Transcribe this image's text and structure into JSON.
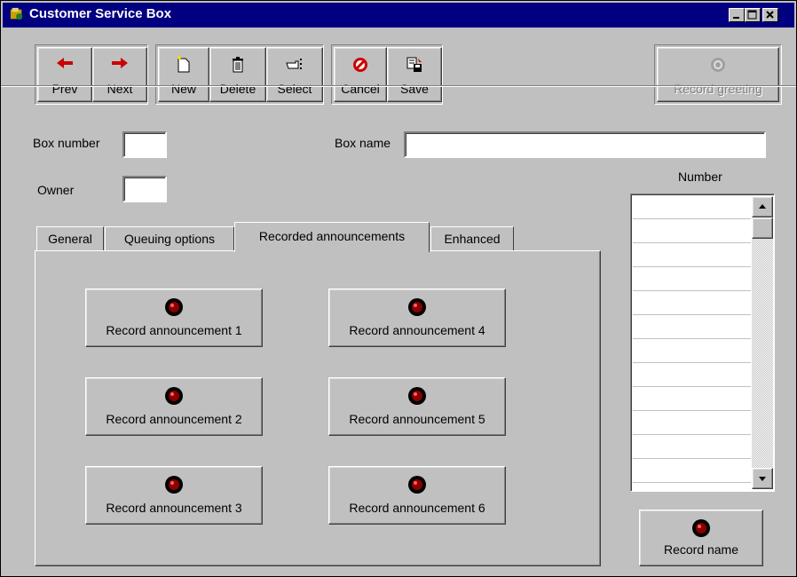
{
  "window": {
    "title": "Customer Service Box"
  },
  "titlebar_buttons": [
    "minimize-icon",
    "maximize-icon",
    "close-icon"
  ],
  "toolbar": {
    "prev_label": "Prev",
    "next_label": "Next",
    "new_label": "New",
    "delete_label": "Delete",
    "select_label": "Select",
    "cancel_label": "Cancel",
    "save_label": "Save",
    "record_greeting_label": "Record greeting"
  },
  "form": {
    "box_number_label": "Box number",
    "box_number_value": "",
    "box_name_label": "Box name",
    "box_name_value": "",
    "owner_label": "Owner",
    "owner_value": "",
    "number_label": "Number"
  },
  "tabs": [
    {
      "label": "General",
      "active": false
    },
    {
      "label": "Queuing options",
      "active": false
    },
    {
      "label": "Recorded announcements",
      "active": true
    },
    {
      "label": "Enhanced",
      "active": false
    }
  ],
  "announcements": {
    "a1": "Record announcement 1",
    "a2": "Record announcement 2",
    "a3": "Record announcement 3",
    "a4": "Record announcement 4",
    "a5": "Record announcement 5",
    "a6": "Record announcement 6"
  },
  "record_name_label": "Record name",
  "colors": {
    "titlebar": "#000080",
    "face": "#c0c0c0",
    "record_dot": "#8b0000"
  }
}
